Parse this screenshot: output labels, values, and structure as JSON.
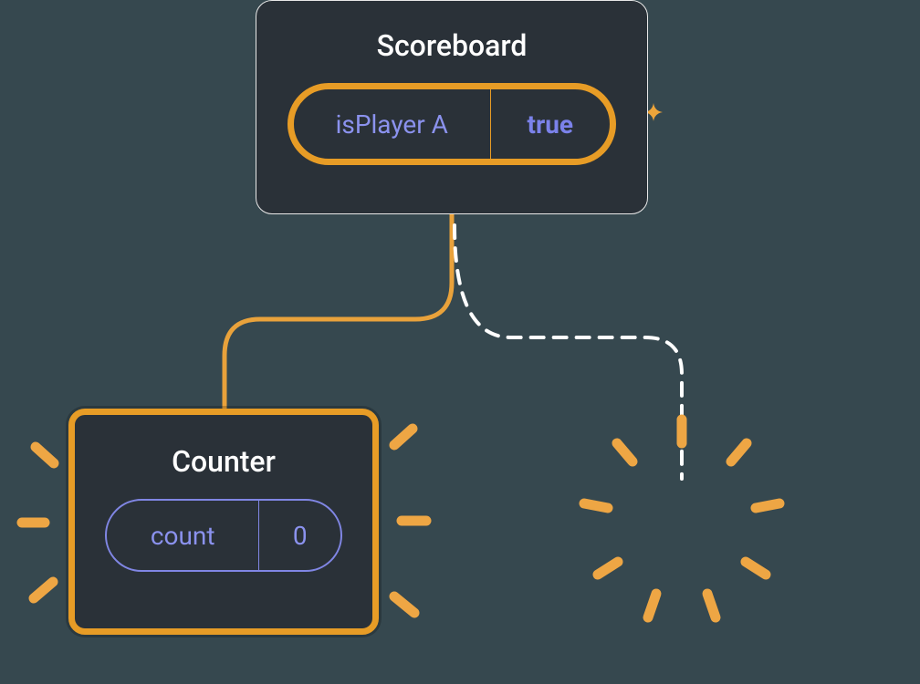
{
  "scoreboard": {
    "title": "Scoreboard",
    "state_key": "isPlayer A",
    "state_value": "true"
  },
  "counter": {
    "title": "Counter",
    "state_key": "count",
    "state_value": "0"
  }
}
